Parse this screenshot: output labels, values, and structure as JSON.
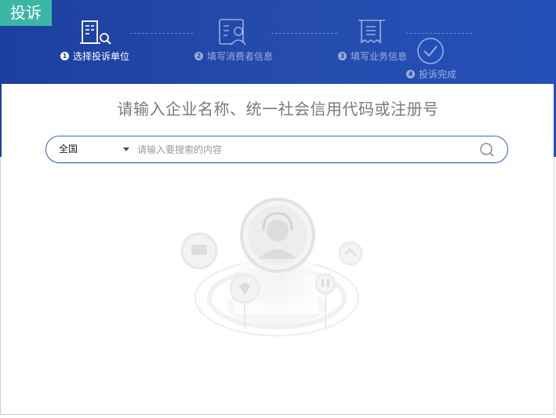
{
  "badge": {
    "label": "投诉"
  },
  "steps": [
    {
      "num": "1",
      "label": "选择投诉单位",
      "active": true,
      "icon": "building-search-icon"
    },
    {
      "num": "2",
      "label": "填写消费者信息",
      "active": false,
      "icon": "user-card-icon"
    },
    {
      "num": "3",
      "label": "填写业务信息",
      "active": false,
      "icon": "document-icon"
    },
    {
      "num": "4",
      "label": "投诉完成",
      "active": false,
      "icon": "check-circle-icon"
    }
  ],
  "prompt": "请输入企业名称、统一社会信用代码或注册号",
  "search": {
    "region_value": "全国",
    "placeholder": "请输入要搜索的内容",
    "value": "",
    "icon": "search-icon"
  },
  "illustration": {
    "icon": "customer-service-illustration"
  },
  "colors": {
    "header": "#2149ab",
    "badge": "#3bb6a5",
    "search_border": "#3a63c8"
  }
}
